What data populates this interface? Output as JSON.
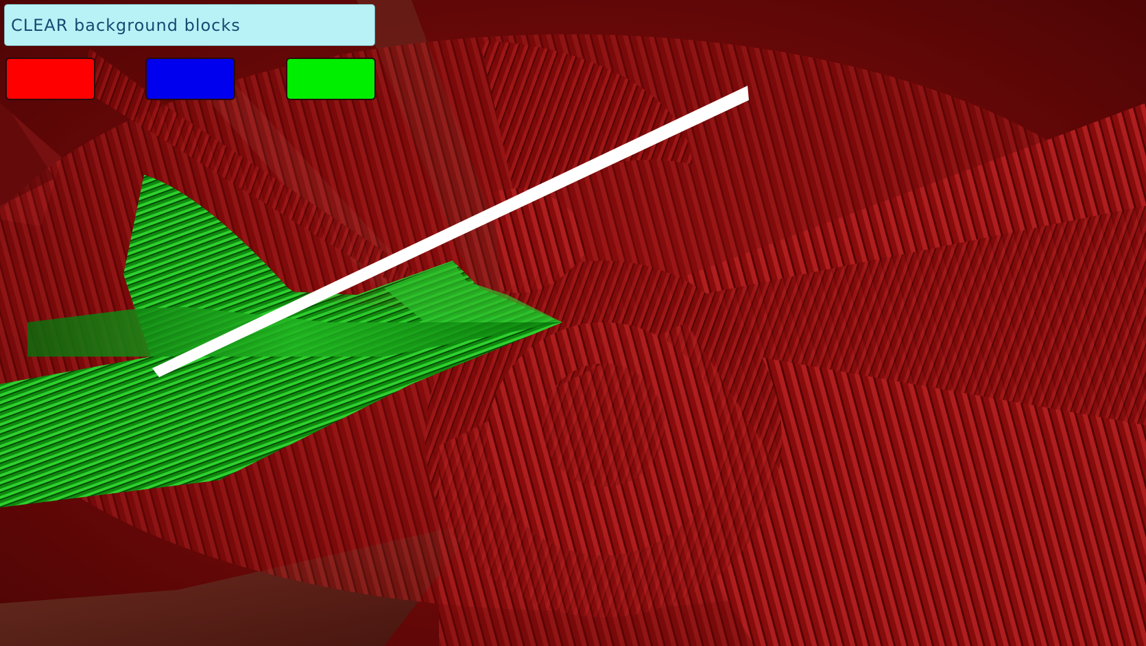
{
  "toolbar": {
    "clear_label": "CLEAR background blocks"
  },
  "colors": {
    "background": "#5a0606",
    "red_swatch": "#ff0000",
    "blue_swatch": "#0000ee",
    "green_swatch": "#00ee00",
    "clear_button": "#b8f2f6",
    "clear_text": "#184a72",
    "line": "#ffffff"
  }
}
